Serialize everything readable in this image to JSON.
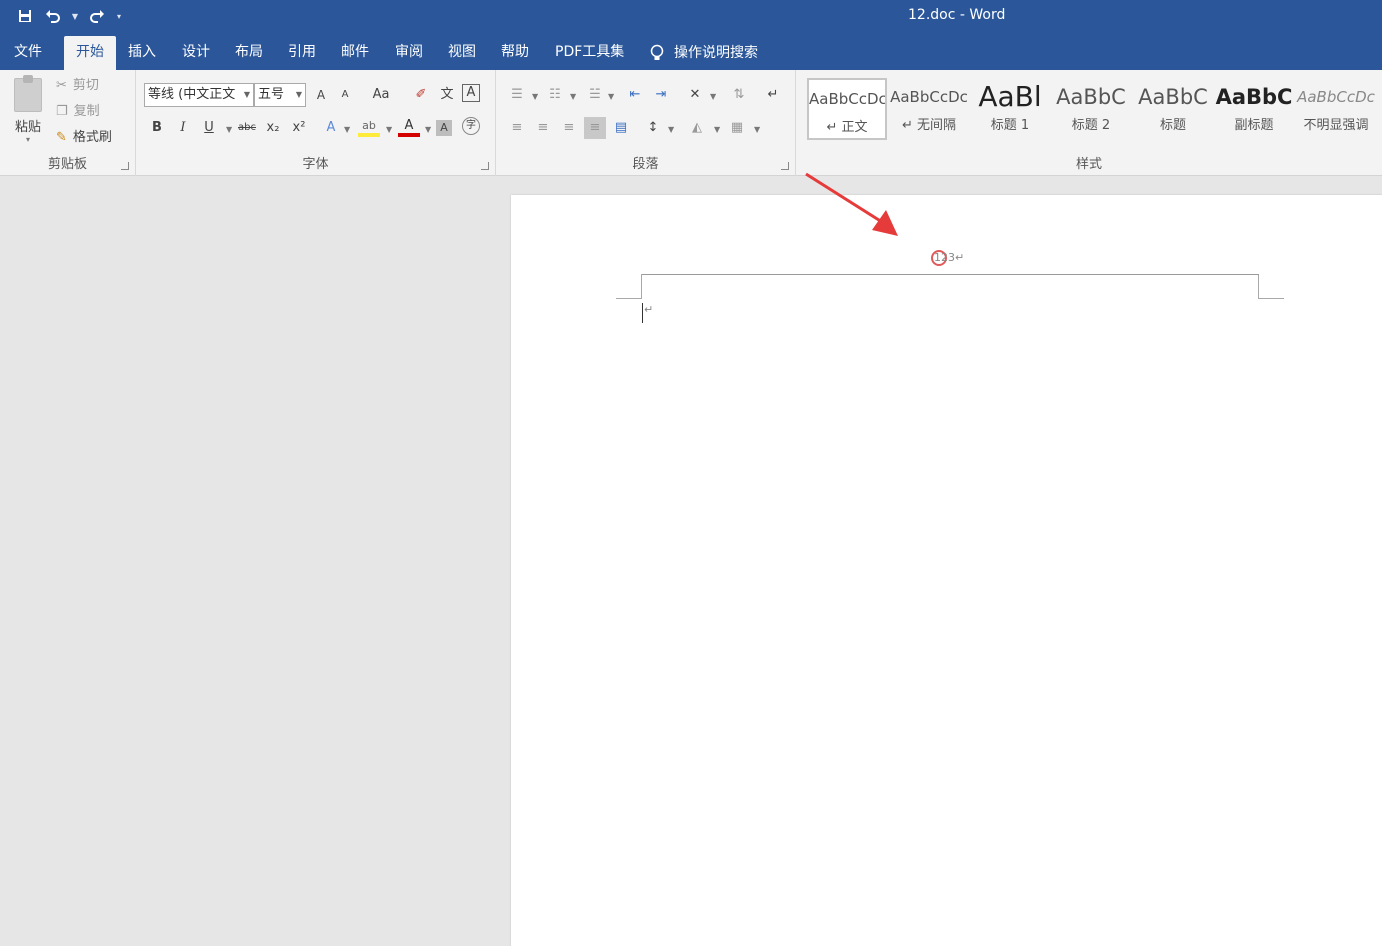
{
  "window": {
    "title": "12.doc  -  Word"
  },
  "qat": {
    "save_icon": "save-icon",
    "undo_icon": "undo-icon",
    "redo_icon": "redo-icon",
    "customize_icon": "customize-icon"
  },
  "tabs": [
    {
      "label": "文件"
    },
    {
      "label": "开始",
      "active": true
    },
    {
      "label": "插入"
    },
    {
      "label": "设计"
    },
    {
      "label": "布局"
    },
    {
      "label": "引用"
    },
    {
      "label": "邮件"
    },
    {
      "label": "审阅"
    },
    {
      "label": "视图"
    },
    {
      "label": "帮助"
    },
    {
      "label": "PDF工具集"
    }
  ],
  "tell_me": {
    "label": "操作说明搜索",
    "icon": "lightbulb-icon"
  },
  "clipboard": {
    "paste_label": "粘贴",
    "cut_label": "剪切",
    "copy_label": "复制",
    "format_painter_label": "格式刷",
    "group_label": "剪贴板"
  },
  "font": {
    "font_name": "等线 (中文正文",
    "font_size": "五号",
    "group_label": "字体",
    "buttons": {
      "bold": "B",
      "italic": "I",
      "underline": "U",
      "strike": "abc",
      "sub": "x₂",
      "sup": "x²",
      "aa": "Aa",
      "grow": "A",
      "shrink": "A",
      "font_color": "A",
      "char_shading": "A",
      "highlight": "ab",
      "text_effects": "A",
      "enclose": "字",
      "char_border": "A",
      "pinyin": "文"
    }
  },
  "paragraph": {
    "group_label": "段落"
  },
  "styles": {
    "group_label": "样式",
    "items": [
      {
        "sample": "AaBbCcDc",
        "name": "↵ 正文"
      },
      {
        "sample": "AaBbCcDc",
        "name": "↵ 无间隔"
      },
      {
        "sample": "AaBl",
        "name": "标题 1"
      },
      {
        "sample": "AaBbC",
        "name": "标题 2"
      },
      {
        "sample": "AaBbC",
        "name": "标题"
      },
      {
        "sample": "AaBbC",
        "name": "副标题"
      },
      {
        "sample": "AaBbCcDc",
        "name": "不明显强调"
      }
    ]
  },
  "document": {
    "header_page_number": "123↵",
    "paragraph_mark": "↵"
  },
  "colors": {
    "title_bar": "#2b579a",
    "annotation_arrow": "#e63b3b"
  }
}
